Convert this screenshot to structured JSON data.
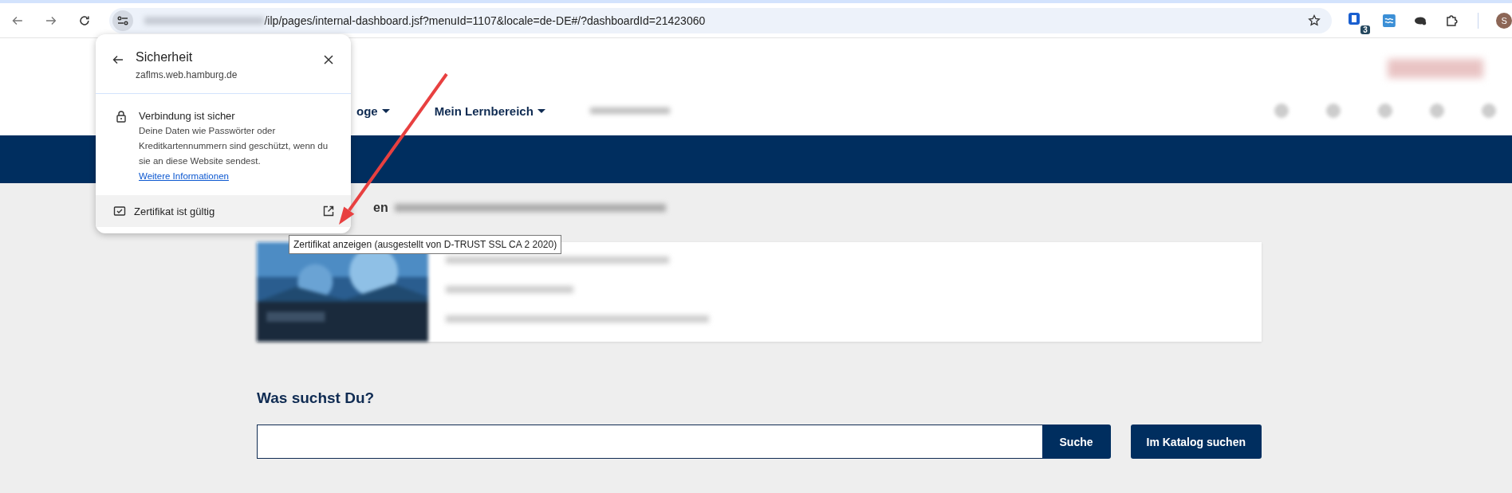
{
  "browser": {
    "url_path": "/ilp/pages/internal-dashboard.jsf?menuId=1107&locale=de-DE#/?dashboardId=21423060",
    "extension_badge": "3",
    "profile_initial": "S"
  },
  "popup": {
    "title": "Sicherheit",
    "host": "zaflms.web.hamburg.de",
    "connection_title": "Verbindung ist sicher",
    "connection_text": "Deine Daten wie Passwörter oder Kreditkartennummern sind geschützt, wenn du sie an diese Website sendest.",
    "link": "Weitere Informationen",
    "certificate": "Zertifikat ist gültig"
  },
  "tooltip": "Zertifikat anzeigen (ausgestellt von D-TRUST SSL CA 2 2020)",
  "nav": {
    "items": [
      {
        "label": "oge"
      },
      {
        "label": "Mein Lernbereich"
      }
    ]
  },
  "section_heading": "en",
  "search": {
    "heading": "Was suchst Du?",
    "button": "Suche",
    "catalog_button": "Im Katalog suchen"
  }
}
